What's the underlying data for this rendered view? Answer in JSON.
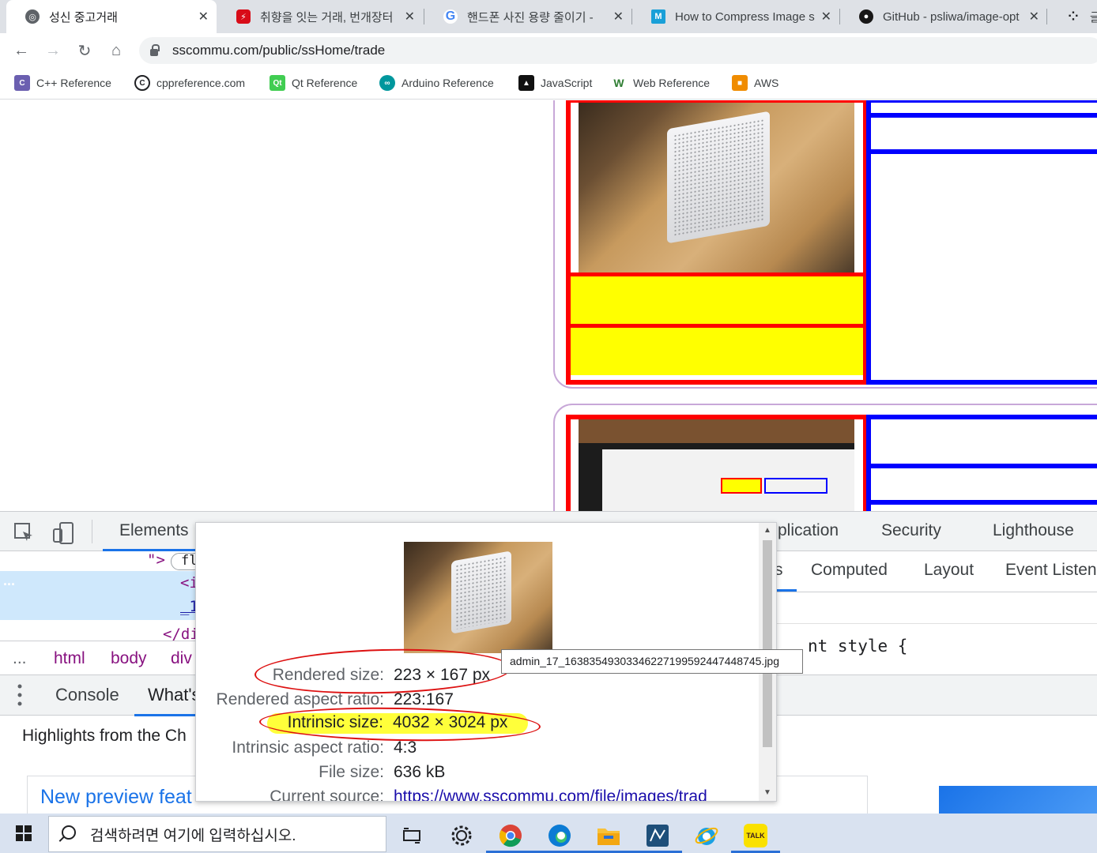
{
  "tabs": [
    {
      "title": "성신 중고거래",
      "icon": "globe-icon",
      "color": "#5f6368",
      "active": true
    },
    {
      "title": "취향을 잇는 거래, 번개장터",
      "icon": "bunjang-icon",
      "color": "#d80c18",
      "active": false
    },
    {
      "title": "핸드폰 사진 용량 줄이기 -",
      "icon": "google-icon",
      "color": "#4285f4",
      "active": false
    },
    {
      "title": "How to Compress Image s",
      "icon": "m-icon",
      "color": "#1aa0d8",
      "active": false
    },
    {
      "title": "GitHub - psliwa/image-opt",
      "icon": "github-icon",
      "color": "#181717",
      "active": false
    },
    {
      "title": "글소",
      "icon": "dots-icon",
      "color": "#202124",
      "active": false
    }
  ],
  "toolbar": {
    "url": "sscommu.com/public/ssHome/trade"
  },
  "bookmarks": [
    {
      "label": "C++ Reference",
      "icon": "cpp-icon",
      "color": "#6b5fb0"
    },
    {
      "label": "cppreference.com",
      "icon": "cppref-icon",
      "color": "#202124"
    },
    {
      "label": "Qt Reference",
      "icon": "qt-icon",
      "color": "#41cd52"
    },
    {
      "label": "Arduino Reference",
      "icon": "arduino-icon",
      "color": "#00979d"
    },
    {
      "label": "JavaScript",
      "icon": "js-icon",
      "color": "#111111"
    },
    {
      "label": "Web Reference",
      "icon": "w3-icon",
      "color": "#2e7d32"
    },
    {
      "label": "AWS",
      "icon": "aws-icon",
      "color": "#f08c00"
    }
  ],
  "devtools": {
    "tabs": {
      "elements": "Elements",
      "application": "plication",
      "security": "Security",
      "lighthouse": "Lighthouse"
    },
    "styles_tabs": {
      "styles": "s",
      "computed": "Computed",
      "layout": "Layout",
      "event_listeners": "Event Listen"
    },
    "dom_lines": [
      "\">",
      "fl",
      "<i",
      "_1",
      "</di"
    ],
    "ellipsis": "...",
    "breadcrumb": {
      "dots": "...",
      "html": "html",
      "body": "body",
      "div": "div"
    },
    "element_style": "nt style {",
    "drawer": {
      "console": "Console",
      "whats_new": "What's"
    },
    "highlights": "Highlights from the Ch",
    "new_preview": "New preview feat"
  },
  "popup": {
    "rendered_size_label": "Rendered size:",
    "rendered_size": "223 × 167 px",
    "rendered_aspect_label": "Rendered aspect ratio:",
    "rendered_aspect": "223:167",
    "intrinsic_size_label": "Intrinsic size:",
    "intrinsic_size": "4032 × 3024 px",
    "intrinsic_aspect_label": "Intrinsic aspect ratio:",
    "intrinsic_aspect": "4:3",
    "file_size_label": "File size:",
    "file_size": "636 kB",
    "current_source_label": "Current source:",
    "current_source": "https://www.sscommu.com/file/images/trad"
  },
  "tooltip": "admin_17_16383549303346227199592447448745.jpg",
  "taskbar": {
    "search_placeholder": "검색하려면 여기에 입력하십시오.",
    "kakao": "TALK"
  },
  "colors": {
    "highlight": "#ffff3a",
    "annotation": "#d11111",
    "red_frame": "#ff0000",
    "blue_frame": "#0000ff",
    "yellow_fill": "#ffff00",
    "card_border": "#c8a8d8"
  }
}
